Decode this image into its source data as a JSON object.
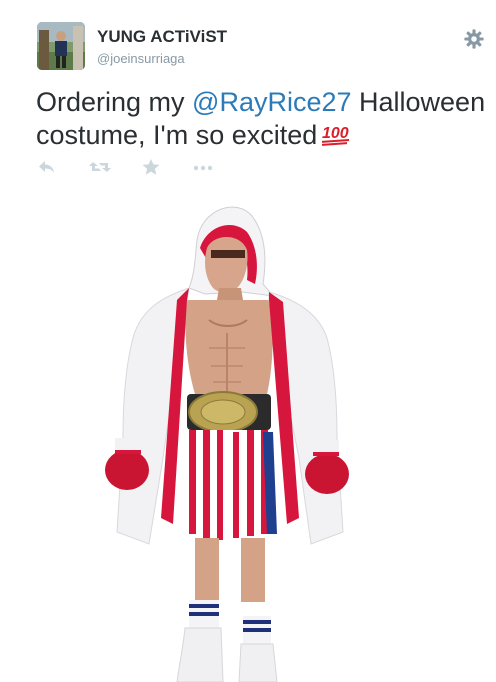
{
  "tweet": {
    "author": {
      "display_name": "YUNG ACTiViST",
      "screen_name": "@joeinsurriaga",
      "avatar_icon": "profile-photo"
    },
    "text_before": "Ordering my ",
    "mention": "@RayRice27",
    "text_after": " Halloween costume, I'm so excited",
    "emoji": "hundred-points-emoji",
    "actions": [
      "reply-icon",
      "retweet-icon",
      "favorite-icon",
      "more-icon"
    ],
    "media": {
      "description_icon": "boxer-costume-photo"
    }
  },
  "colors": {
    "link": "#2b7bb9",
    "muted": "#8899a6",
    "text": "#292f33"
  }
}
